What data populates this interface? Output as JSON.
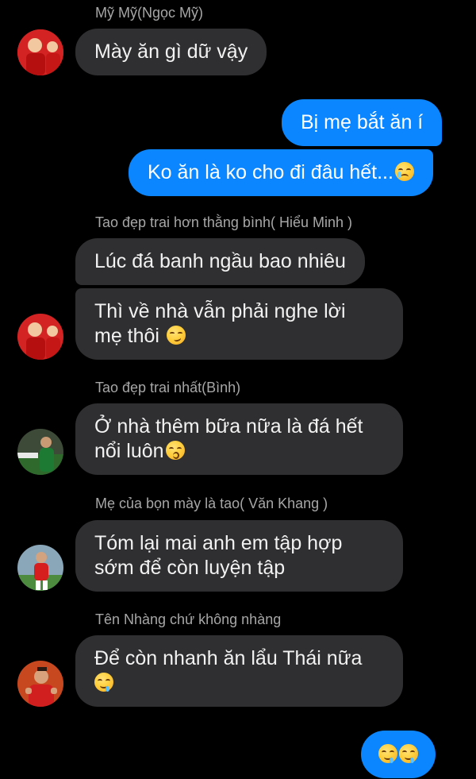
{
  "chat": {
    "messages": [
      {
        "sender": "Mỹ Mỹ(Ngọc Mỹ)",
        "text": "Mày ăn gì dữ vậy"
      },
      {
        "text": "Bị mẹ bắt ăn í"
      },
      {
        "text": "Ko ăn là ko cho đi đâu hết...",
        "emoji": "crying-face"
      },
      {
        "sender": "Tao đẹp trai hơn thằng bình( Hiểu Minh )",
        "text": "Lúc đá banh ngầu bao nhiêu"
      },
      {
        "line1": "Thì về nhà vẫn phải nghe lời",
        "line2": "mẹ thôi",
        "emoji": "smirking-face"
      },
      {
        "sender": "Tao đẹp trai nhất(Bình)",
        "line1": "Ở nhà thêm bữa nữa là đá hết",
        "line2": "nổi luôn",
        "emoji": "kissing-face"
      },
      {
        "sender": "Mẹ của bọn mày là tao( Văn Khang )",
        "line1": "Tóm lại mai anh em tập hợp",
        "line2": "sớm để còn luyện tập"
      },
      {
        "sender": "Tên Nhàng chứ không nhàng",
        "line1": "Để còn nhanh ăn lẩu Thái nữa",
        "emoji": "drooling-face"
      },
      {
        "emoji": "drooling-face"
      }
    ]
  },
  "colors": {
    "background": "#000000",
    "incoming_bubble": "#2f2f31",
    "outgoing_bubble": "#0b86ff",
    "sender_text": "#a7a7a7"
  }
}
